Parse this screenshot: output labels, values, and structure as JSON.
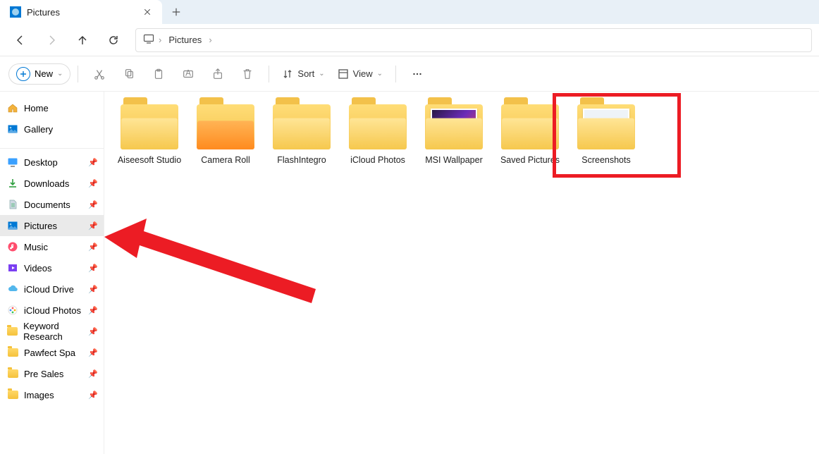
{
  "tab": {
    "title": "Pictures"
  },
  "address": {
    "location": "Pictures"
  },
  "toolbar": {
    "new_label": "New",
    "sort_label": "Sort",
    "view_label": "View"
  },
  "sidebar": {
    "top": [
      {
        "label": "Home",
        "icon": "home"
      },
      {
        "label": "Gallery",
        "icon": "gallery"
      }
    ],
    "pinned": [
      {
        "label": "Desktop",
        "icon": "desktop"
      },
      {
        "label": "Downloads",
        "icon": "downloads"
      },
      {
        "label": "Documents",
        "icon": "documents"
      },
      {
        "label": "Pictures",
        "icon": "pictures",
        "selected": true
      },
      {
        "label": "Music",
        "icon": "music"
      },
      {
        "label": "Videos",
        "icon": "videos"
      },
      {
        "label": "iCloud Drive",
        "icon": "iclouddrive"
      },
      {
        "label": "iCloud Photos",
        "icon": "icloudphotos"
      },
      {
        "label": "Keyword Research",
        "icon": "folder"
      },
      {
        "label": "Pawfect Spa",
        "icon": "folder"
      },
      {
        "label": "Pre Sales",
        "icon": "folder"
      },
      {
        "label": "Images",
        "icon": "folder"
      }
    ]
  },
  "folders": [
    {
      "label": "Aiseesoft Studio",
      "variant": "closed"
    },
    {
      "label": "Camera Roll",
      "variant": "open"
    },
    {
      "label": "FlashIntegro",
      "variant": "closed"
    },
    {
      "label": "iCloud Photos",
      "variant": "closed"
    },
    {
      "label": "MSI Wallpaper",
      "variant": "thumb-msi"
    },
    {
      "label": "Saved Pictures",
      "variant": "closed"
    },
    {
      "label": "Screenshots",
      "variant": "thumb-shot",
      "highlighted": true
    }
  ],
  "annotations": {
    "highlight_target": "Screenshots",
    "arrow_target": "Pictures"
  }
}
